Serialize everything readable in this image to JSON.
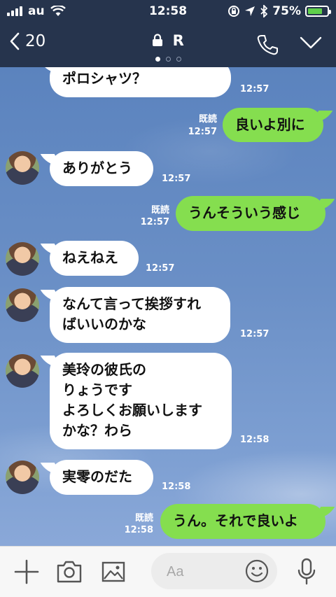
{
  "status": {
    "carrier": "au",
    "time": "12:58",
    "battery": "75%",
    "battery_level": 0.75
  },
  "nav": {
    "back_count": "20",
    "title": "R",
    "page_dots": 3,
    "active_dot": 0
  },
  "messages": [
    {
      "dir": "in",
      "text": "ポロシャツ？",
      "time": "12:57"
    },
    {
      "dir": "out",
      "text": "良いよ別に",
      "read": "既読",
      "time": "12:57"
    },
    {
      "dir": "in",
      "text": "ありがとう",
      "time": "12:57"
    },
    {
      "dir": "out",
      "text": "うんそういう感じ",
      "read": "既読",
      "time": "12:57"
    },
    {
      "dir": "in",
      "text": "ねえねえ",
      "time": "12:57"
    },
    {
      "dir": "in",
      "line1": "なんて言って挨拶すれ",
      "line2": "ばいいのかな",
      "time": "12:57"
    },
    {
      "dir": "in",
      "line1": "美玲の彼氏の",
      "line2": "りょうです",
      "line3": "よろしくお願いします",
      "line4": "かな？わら",
      "time": "12:58"
    },
    {
      "dir": "in",
      "text": "実零のだた",
      "time": "12:58"
    },
    {
      "dir": "out",
      "text": "うん。それで良いよ",
      "read": "既読",
      "time": "12:58"
    }
  ],
  "input": {
    "placeholder": "Aa"
  },
  "icons": {
    "plus": "plus-icon",
    "camera": "camera-icon",
    "image": "image-icon",
    "emoji": "emoji-icon",
    "mic": "microphone-icon",
    "phone": "phone-icon",
    "chevron": "chevron-down-icon",
    "lock": "lock-icon"
  },
  "colors": {
    "header": "#26344d",
    "outgoing_bubble": "#85de4f",
    "incoming_bubble": "#ffffff",
    "icon_gray": "#555555"
  }
}
